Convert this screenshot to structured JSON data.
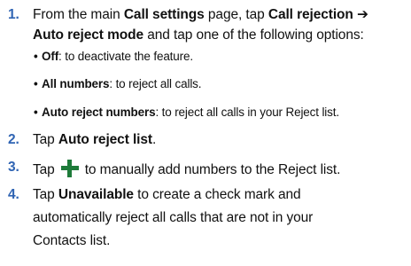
{
  "steps": [
    {
      "number": "1.",
      "line1": {
        "t1": "From the main ",
        "b1": "Call settings",
        "t2": " page, tap ",
        "b2": "Call rejection ➔"
      },
      "line2": {
        "b1": "Auto reject mode",
        "t1": " and tap one of the following options:"
      },
      "bullets": [
        {
          "bold": "Off",
          "text": ": to deactivate the feature."
        },
        {
          "bold": "All numbers",
          "text": ": to reject all calls."
        },
        {
          "bold": "Auto reject numbers",
          "text": ": to reject all calls in your Reject list."
        }
      ]
    },
    {
      "number": "2.",
      "t1": "Tap ",
      "b1": "Auto reject list",
      "t2": "."
    },
    {
      "number": "3.",
      "t1": "Tap",
      "icon": "plus-icon",
      "t2": "to manually add numbers to the Reject list."
    },
    {
      "number": "4.",
      "line1": {
        "t1": "Tap ",
        "b1": "Unavailable",
        "t2": " to create a check mark and"
      },
      "line2": "automatically reject all calls that are not in your",
      "line3": "Contacts list."
    }
  ],
  "colors": {
    "step_number": "#2f64b3",
    "plus_icon": "#1e7b3a",
    "text": "#111111"
  }
}
